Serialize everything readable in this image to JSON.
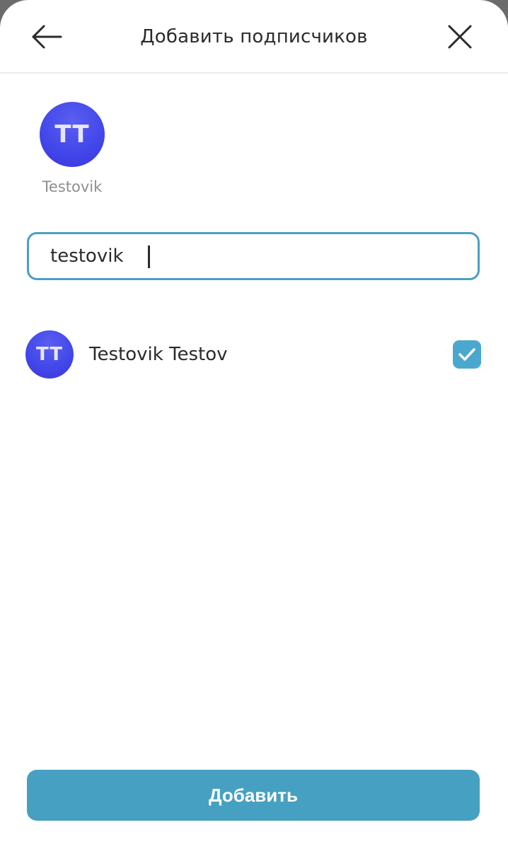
{
  "header": {
    "title": "Добавить подписчиков",
    "back_icon": "arrow-left-icon",
    "close_icon": "close-icon"
  },
  "selected": [
    {
      "initials": "TT",
      "name": "Testovik"
    }
  ],
  "search": {
    "value": "testovik",
    "border_color": "#4aa0c1"
  },
  "results": [
    {
      "initials": "TT",
      "name": "Testovik Testov",
      "checked": true
    }
  ],
  "footer": {
    "add_label": "Добавить",
    "button_color": "#46a0c1"
  },
  "colors": {
    "accent": "#4aa8cf",
    "avatar": "#4348ea"
  }
}
